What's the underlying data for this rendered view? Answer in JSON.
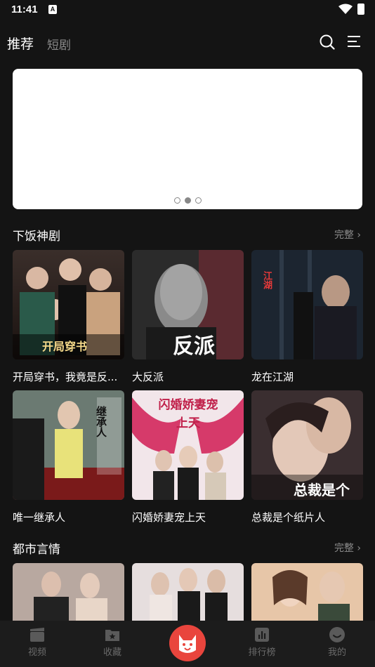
{
  "status": {
    "time": "11:41",
    "notif_letter": "A"
  },
  "nav": {
    "tab_recommend": "推荐",
    "tab_short": "短剧"
  },
  "banner": {
    "page_count": 3,
    "active_index": 1
  },
  "sections": [
    {
      "title": "下饭神剧",
      "more": "完整 ›",
      "items": [
        {
          "title": "开局穿书，我竟是反...",
          "poster_text": "开局穿书"
        },
        {
          "title": "大反派",
          "poster_text": "反派"
        },
        {
          "title": "龙在江湖",
          "poster_text": "江湖"
        },
        {
          "title": "唯一继承人",
          "poster_text": "继承人"
        },
        {
          "title": "闪婚娇妻宠上天",
          "poster_text": "闪婚娇妻宠上天"
        },
        {
          "title": "总裁是个纸片人",
          "poster_text": "总裁是个"
        }
      ]
    },
    {
      "title": "都市言情",
      "more": "完整 ›"
    }
  ],
  "tabbar": {
    "video": "视频",
    "favorite": "收藏",
    "ranking": "排行榜",
    "mine": "我的"
  },
  "colors": {
    "accent": "#e9453d",
    "background": "#141414",
    "muted": "#8c8c8c"
  }
}
